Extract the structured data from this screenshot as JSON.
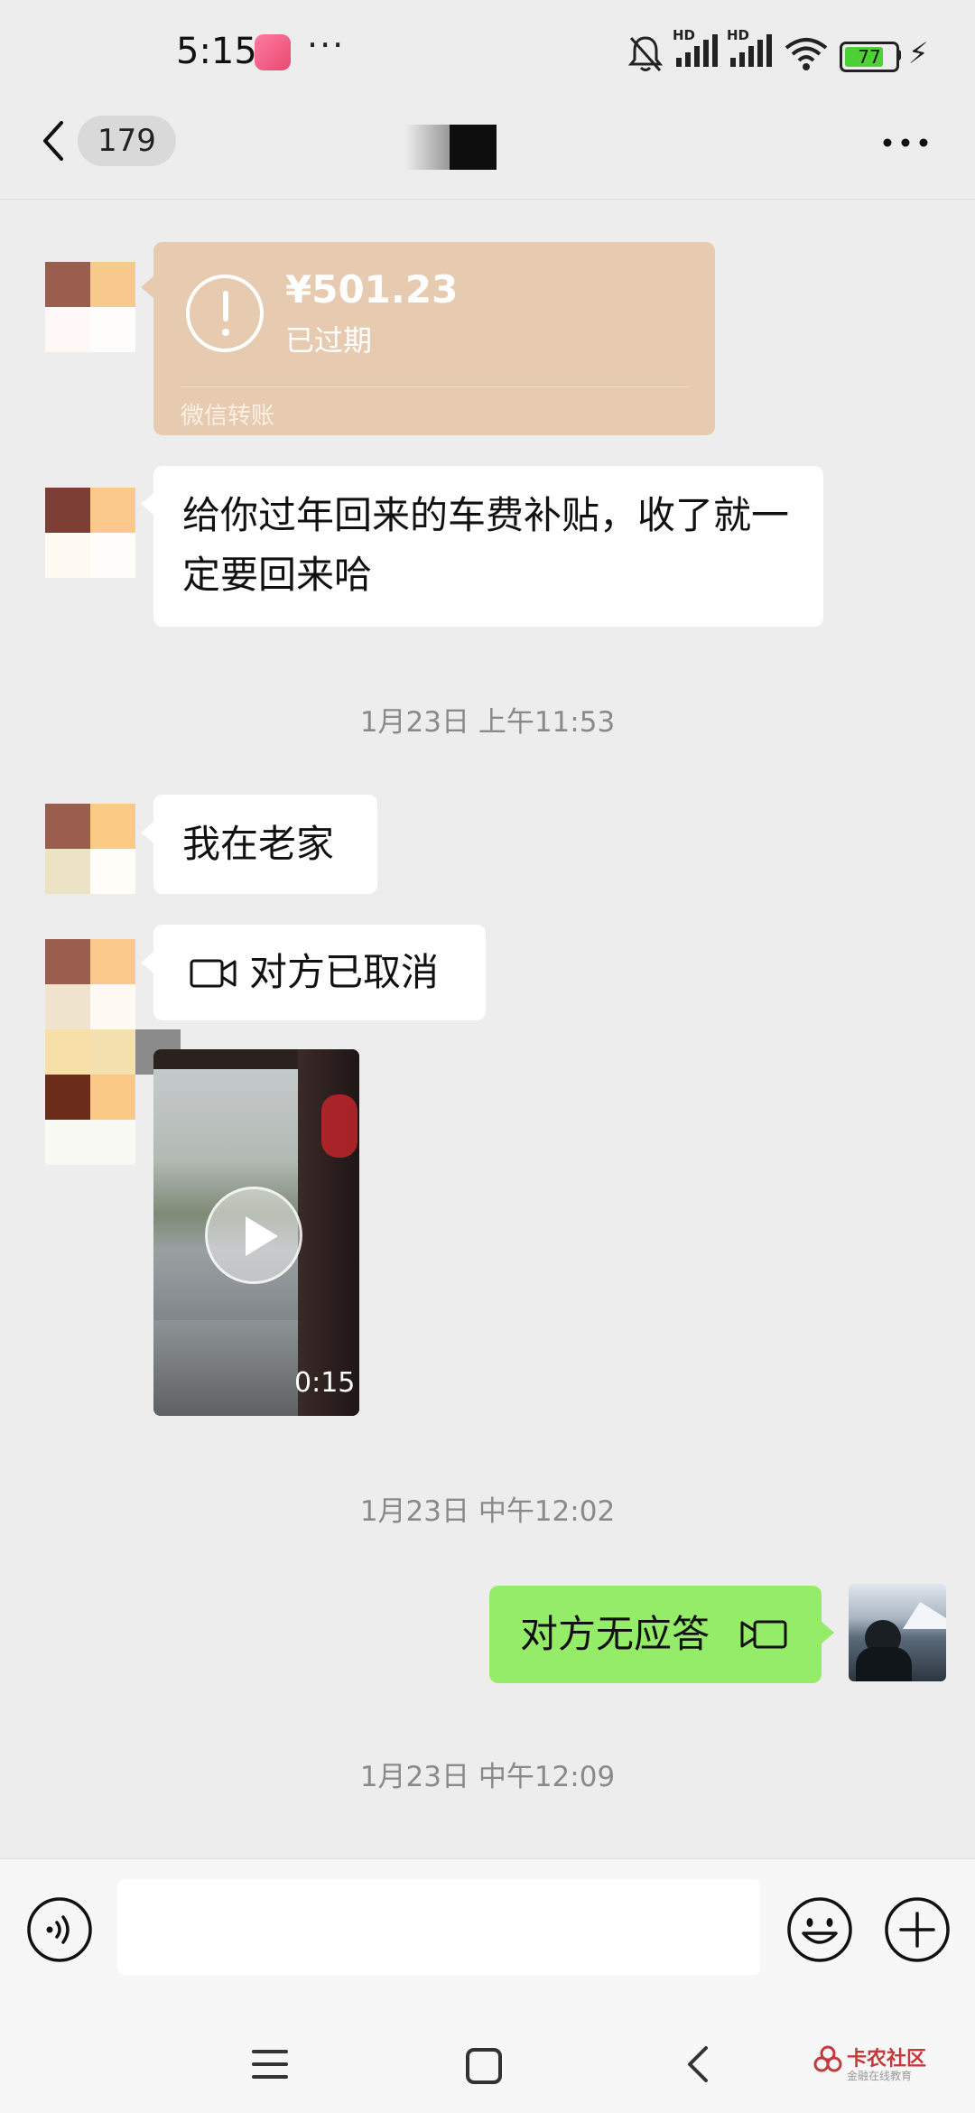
{
  "status_bar": {
    "time": "5:15",
    "more": "···",
    "signal_label_1": "HD",
    "signal_label_2": "HD",
    "battery": "77"
  },
  "title_bar": {
    "unread_count": "179"
  },
  "messages": {
    "transfer": {
      "amount": "¥501.23",
      "status": "已过期",
      "source": "微信转账"
    },
    "text_1": "给你过年回来的车费补贴，收了就一定要回来哈",
    "timestamp_1": "1月23日 上午11:53",
    "text_2": "我在老家",
    "video_call_1": "对方已取消",
    "video_duration": "0:15",
    "timestamp_2": "1月23日 中午12:02",
    "video_call_2": "对方无应答",
    "timestamp_3": "1月23日 中午12:09"
  },
  "watermark": {
    "brand": "卡农社区",
    "sub": "金融在线教育"
  },
  "colors": {
    "accent_green": "#95ec69",
    "transfer_expired": "#e7cbb0",
    "background": "#ededed"
  },
  "icons": [
    "back-icon",
    "more-icon",
    "expired-icon",
    "video-call-icon",
    "play-icon",
    "voice-icon",
    "emoji-icon",
    "plus-icon",
    "nav-menu-icon",
    "nav-home-icon",
    "nav-back-icon"
  ]
}
